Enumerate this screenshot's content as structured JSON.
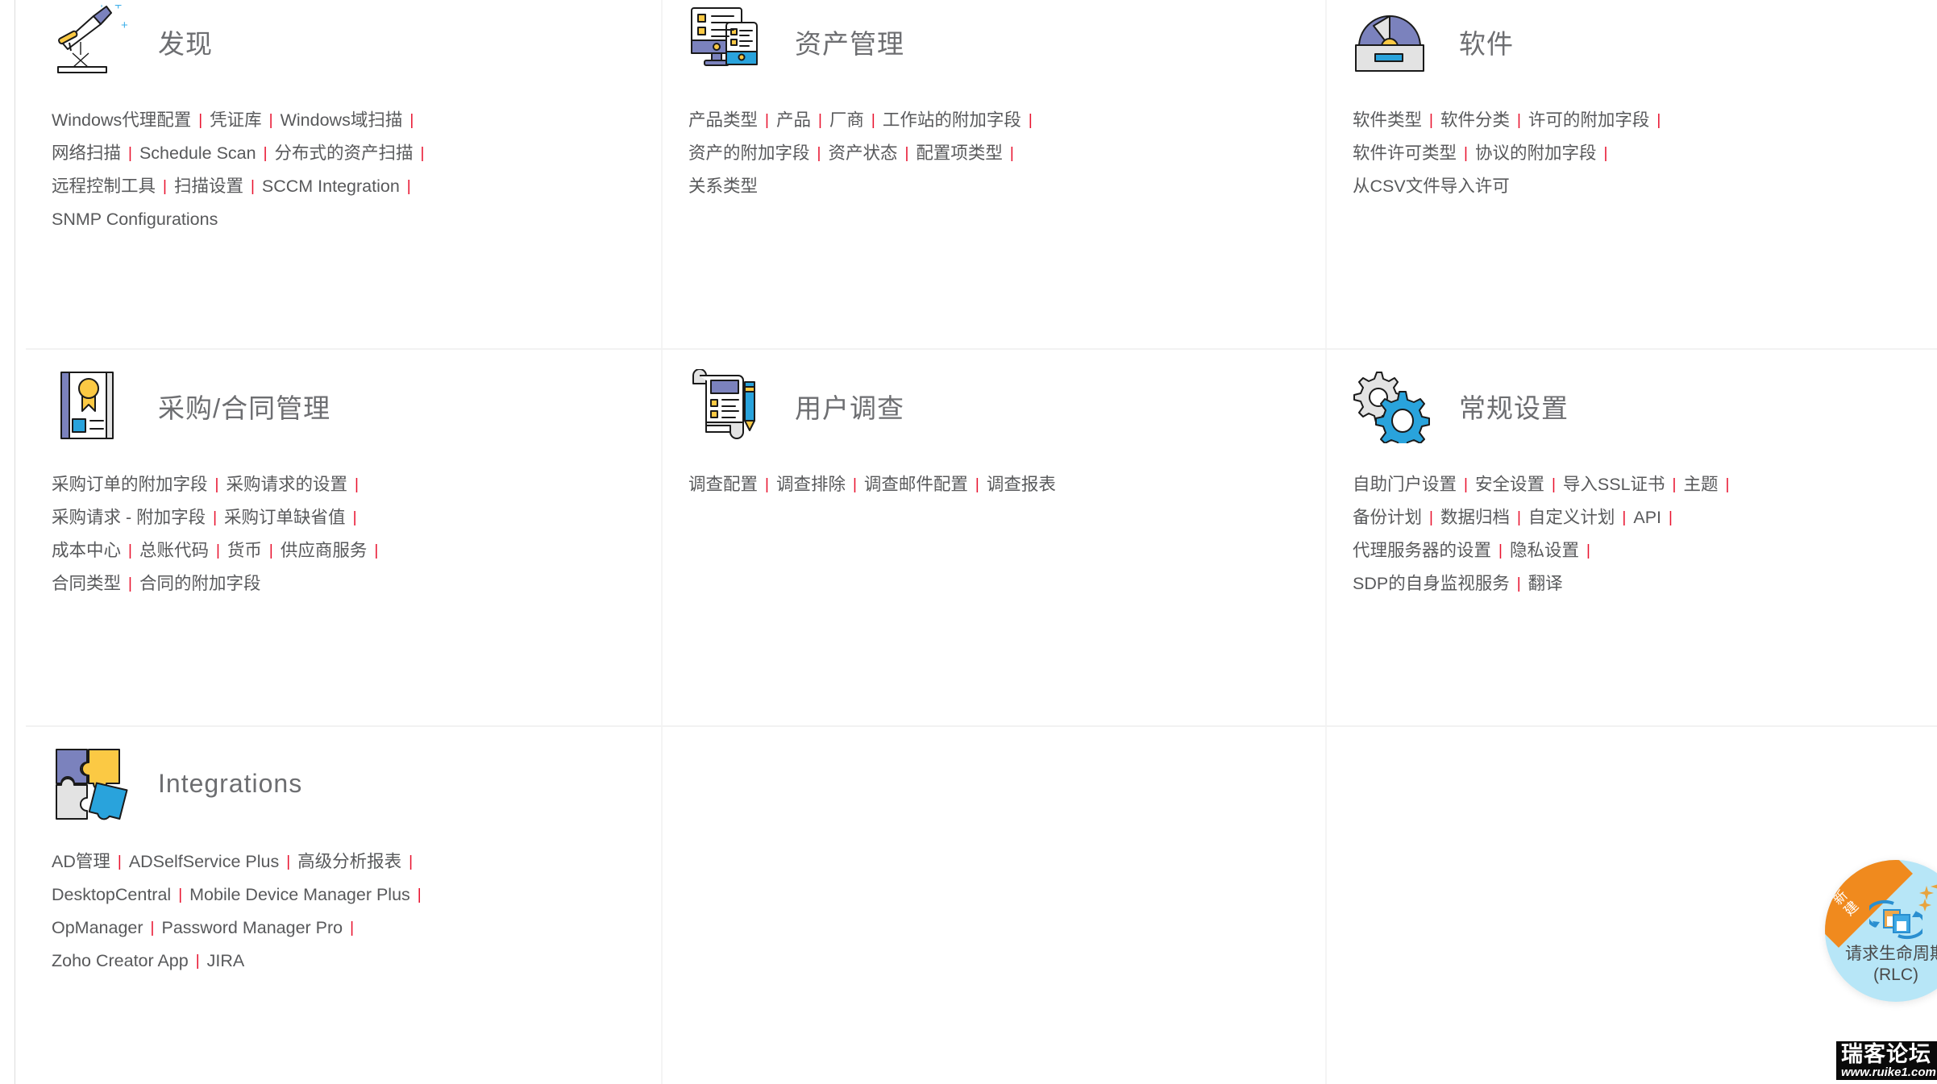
{
  "cards": [
    {
      "id": "discovery",
      "title": "发现",
      "icon": "telescope-icon",
      "links": [
        "Windows代理配置",
        "凭证库",
        "Windows域扫描",
        "网络扫描",
        "Schedule Scan",
        "分布式的资产扫描",
        "远程控制工具",
        "扫描设置",
        "SCCM Integration",
        "SNMP Configurations"
      ],
      "line_breaks": [
        3,
        6,
        9
      ]
    },
    {
      "id": "asset-management",
      "title": "资产管理",
      "icon": "monitor-list-icon",
      "links": [
        "产品类型",
        "产品",
        "厂商",
        "工作站的附加字段",
        "资产的附加字段",
        "资产状态",
        "配置项类型",
        "关系类型"
      ],
      "line_breaks": [
        4,
        7
      ]
    },
    {
      "id": "software",
      "title": "软件",
      "icon": "cd-disc-icon",
      "links": [
        "软件类型",
        "软件分类",
        "许可的附加字段",
        "软件许可类型",
        "协议的附加字段",
        "从CSV文件导入许可"
      ],
      "line_breaks": [
        3,
        5
      ]
    },
    {
      "id": "purchase-contract-management",
      "title": "采购/合同管理",
      "icon": "contract-book-icon",
      "links": [
        "采购订单的附加字段",
        "采购请求的设置",
        "采购请求 - 附加字段",
        "采购订单缺省值",
        "成本中心",
        "总账代码",
        "货币",
        "供应商服务",
        "合同类型",
        "合同的附加字段"
      ],
      "line_breaks": [
        2,
        4,
        8
      ]
    },
    {
      "id": "user-survey",
      "title": "用户调查",
      "icon": "scroll-pen-icon",
      "links": [
        "调查配置",
        "调查排除",
        "调查邮件配置",
        "调查报表"
      ],
      "line_breaks": []
    },
    {
      "id": "general-settings",
      "title": "常规设置",
      "icon": "gears-icon",
      "links": [
        "自助门户设置",
        "安全设置",
        "导入SSL证书",
        "主题",
        "备份计划",
        "数据归档",
        "自定义计划",
        "API",
        "代理服务器的设置",
        "隐私设置",
        "SDP的自身监视服务",
        "翻译"
      ],
      "line_breaks": [
        4,
        8,
        10
      ]
    },
    {
      "id": "integrations",
      "title": "Integrations",
      "icon": "puzzle-icon",
      "links": [
        "AD管理",
        "ADSelfService Plus",
        "高级分析报表",
        "DesktopCentral",
        "Mobile Device Manager Plus",
        "OpManager",
        "Password Manager Pro",
        "Zoho Creator App",
        "JIRA"
      ],
      "line_breaks": [
        3,
        5,
        7
      ]
    }
  ],
  "floating_badge": {
    "ribbon_label": "新建",
    "label": "请求生命周期",
    "sublabel": "(RLC)"
  },
  "watermark": {
    "title": "瑞客论坛",
    "url": "www.ruike1.com"
  },
  "colors": {
    "separator_red": "#e8112d",
    "link_text": "#58595b",
    "title_text": "#6d6e71",
    "icon_purple": "#7b82bd",
    "icon_yellow": "#fbc944",
    "icon_blue": "#29a3dc",
    "icon_gray": "#e3e3e3",
    "badge_bg": "#b7e6f7",
    "badge_ribbon": "#f08a1e"
  }
}
